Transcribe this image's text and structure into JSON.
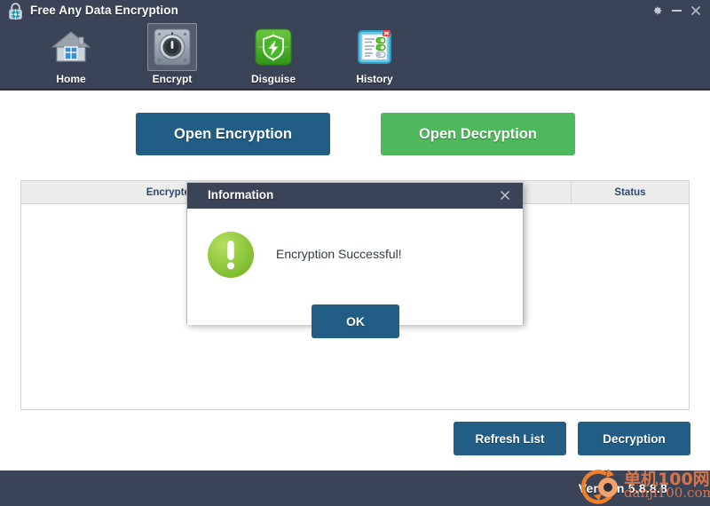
{
  "window": {
    "title": "Free Any Data Encryption",
    "logo_icon": "padlock-icon",
    "controls": {
      "settings_icon": "gear-icon",
      "settings_label": "Settings",
      "minimize_icon": "minimize-icon",
      "minimize_label": "Minimize",
      "close_icon": "close-icon",
      "close_label": "Close"
    }
  },
  "toolbar": {
    "items": [
      {
        "id": "home",
        "label": "Home",
        "icon": "house-icon",
        "selected": false
      },
      {
        "id": "encrypt",
        "label": "Encrypt",
        "icon": "safe-dial-icon",
        "selected": true
      },
      {
        "id": "disguise",
        "label": "Disguise",
        "icon": "shield-bolt-icon",
        "selected": false
      },
      {
        "id": "history",
        "label": "History",
        "icon": "list-window-icon",
        "selected": false
      }
    ]
  },
  "main": {
    "open_encryption_label": "Open Encryption",
    "open_decryption_label": "Open Decryption",
    "table": {
      "columns": [
        "Encrypted File/Folder",
        "",
        "Status"
      ],
      "rows": []
    },
    "refresh_label": "Refresh List",
    "decryption_label": "Decryption"
  },
  "footer": {
    "version": "Version 5.8.8.8",
    "watermark_cn": "单机100网",
    "watermark_url": "danji100.com",
    "watermark_icon": "circular-arrow-logo"
  },
  "dialog": {
    "title": "Information",
    "message": "Encryption Successful!",
    "ok_label": "OK",
    "close_icon": "close-icon",
    "icon": "exclamation-circle-icon"
  },
  "colors": {
    "header_bg": "#3b4356",
    "primary_blue": "#215d85",
    "accent_green": "#4fb75c",
    "dialog_icon_green": "#8dc63f",
    "watermark_orange": "#e27b49"
  }
}
